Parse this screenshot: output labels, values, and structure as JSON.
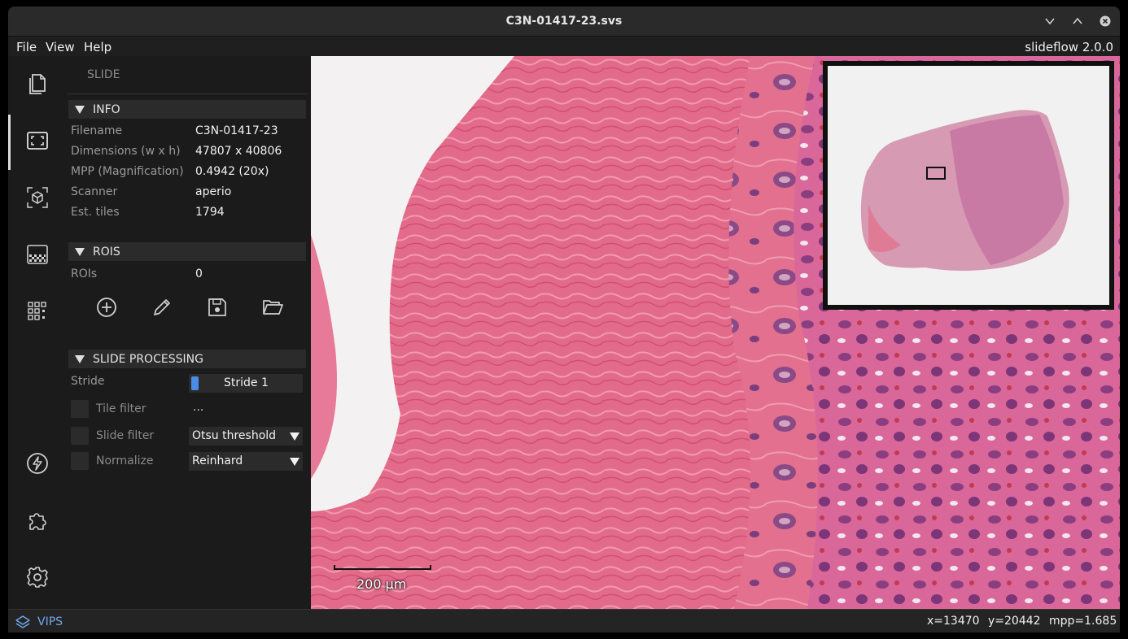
{
  "window": {
    "title": "C3N-01417-23.svs"
  },
  "menu": {
    "items": [
      "File",
      "View",
      "Help"
    ],
    "version": "slideflow 2.0.0"
  },
  "panel": {
    "heading": "SLIDE",
    "info": {
      "title": "INFO",
      "rows": [
        {
          "key": "Filename",
          "value": "C3N-01417-23"
        },
        {
          "key": "Dimensions (w x h)",
          "value": "47807 x 40806"
        },
        {
          "key": "MPP (Magnification)",
          "value": "0.4942 (20x)"
        },
        {
          "key": "Scanner",
          "value": "aperio"
        },
        {
          "key": "Est. tiles",
          "value": "1794"
        }
      ]
    },
    "rois": {
      "title": "ROIS",
      "rows": [
        {
          "key": "ROIs",
          "value": "0"
        }
      ],
      "icons": [
        "add-circle-icon",
        "pencil-icon",
        "save-icon",
        "folder-open-icon"
      ]
    },
    "processing": {
      "title": "SLIDE PROCESSING",
      "stride_label": "Stride",
      "stride_value": "Stride 1",
      "tile_filter_label": "Tile filter",
      "tile_filter_value": "...",
      "slide_filter_label": "Slide filter",
      "slide_filter_value": "Otsu threshold",
      "normalize_label": "Normalize",
      "normalize_value": "Reinhard"
    }
  },
  "rail": {
    "icons": [
      "files-icon",
      "slide-icon",
      "model-cube-icon",
      "heatmap-icon",
      "mosaic-icon",
      "lightning-icon",
      "extensions-puzzle-icon",
      "settings-gear-icon"
    ],
    "active": "slide-icon"
  },
  "viewer": {
    "scale_label": "200 µm"
  },
  "status": {
    "backend": "VIPS",
    "x": "x=13470",
    "y": "y=20442",
    "mpp": "mpp=1.685"
  },
  "colors": {
    "accent": "#4a8de6",
    "backend_text": "#6fa8ef",
    "tissue": "#d8608c"
  }
}
